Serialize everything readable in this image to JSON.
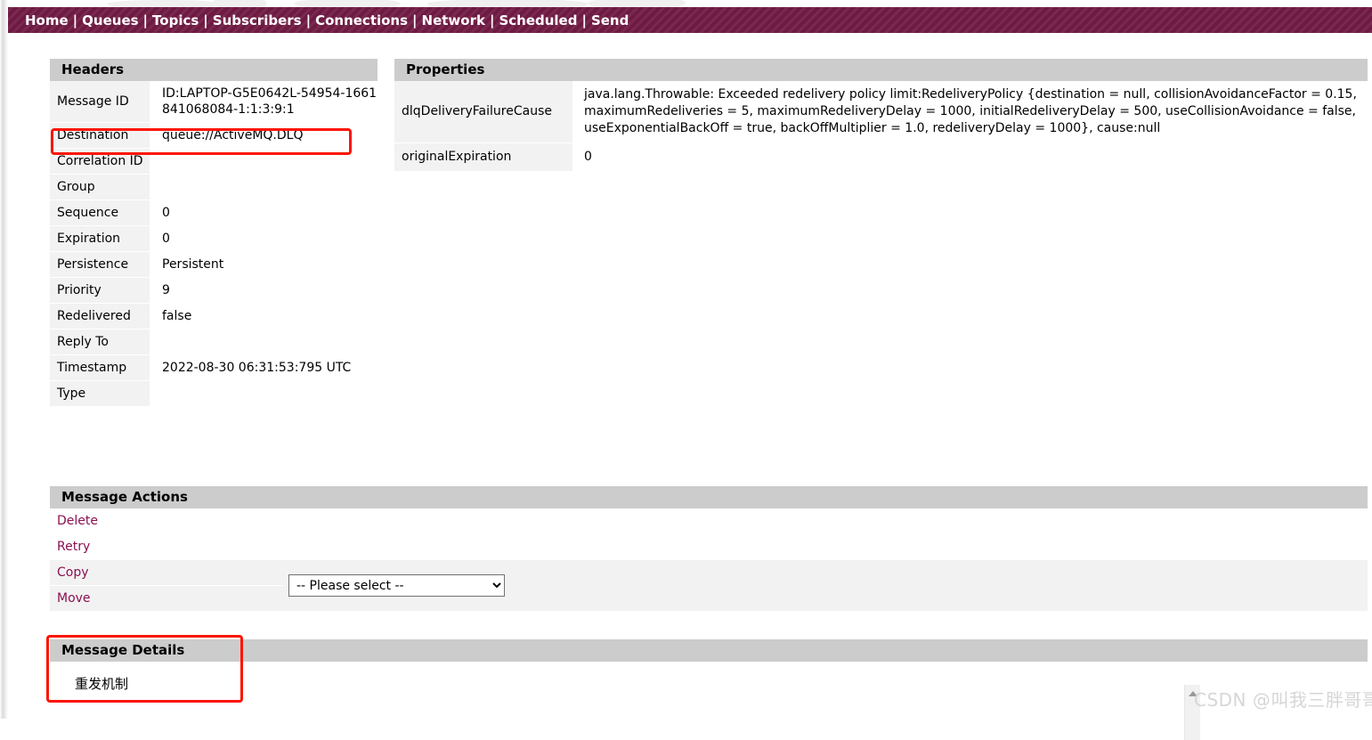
{
  "nav": {
    "items": [
      {
        "label": "Home"
      },
      {
        "label": "Queues"
      },
      {
        "label": "Topics"
      },
      {
        "label": "Subscribers"
      },
      {
        "label": "Connections"
      },
      {
        "label": "Network"
      },
      {
        "label": "Scheduled"
      },
      {
        "label": "Send"
      }
    ],
    "separator": "|",
    "background_color": "#6e1a42",
    "text_color": "#ffffff"
  },
  "headers_panel": {
    "title": "Headers",
    "rows": [
      {
        "key": "Message ID",
        "value": "ID:LAPTOP-G5E0642L-54954-1661841068084-1:1:3:9:1"
      },
      {
        "key": "Destination",
        "value": "queue://ActiveMQ.DLQ"
      },
      {
        "key": "Correlation ID",
        "value": ""
      },
      {
        "key": "Group",
        "value": ""
      },
      {
        "key": "Sequence",
        "value": "0"
      },
      {
        "key": "Expiration",
        "value": "0"
      },
      {
        "key": "Persistence",
        "value": "Persistent"
      },
      {
        "key": "Priority",
        "value": "9"
      },
      {
        "key": "Redelivered",
        "value": "false"
      },
      {
        "key": "Reply To",
        "value": ""
      },
      {
        "key": "Timestamp",
        "value": "2022-08-30 06:31:53:795 UTC"
      },
      {
        "key": "Type",
        "value": ""
      }
    ]
  },
  "properties_panel": {
    "title": "Properties",
    "rows": [
      {
        "key": "dlqDeliveryFailureCause",
        "value": "java.lang.Throwable: Exceeded redelivery policy limit:RedeliveryPolicy {destination = null, collisionAvoidanceFactor = 0.15, maximumRedeliveries = 5, maximumRedeliveryDelay = 1000, initialRedeliveryDelay = 500, useCollisionAvoidance = false, useExponentialBackOff = true, backOffMultiplier = 1.0, redeliveryDelay = 1000}, cause:null"
      },
      {
        "key": "originalExpiration",
        "value": "0"
      }
    ]
  },
  "message_actions": {
    "title": "Message Actions",
    "links": [
      {
        "label": "Delete"
      },
      {
        "label": "Retry"
      },
      {
        "label": "Copy"
      },
      {
        "label": "Move"
      }
    ],
    "select": {
      "selected": "-- Please select --",
      "options": [
        "-- Please select --"
      ]
    },
    "link_color": "#8a1052"
  },
  "message_details": {
    "title": "Message Details",
    "body": "重发机制"
  },
  "annotations": {
    "color": "#fc1505",
    "boxes": [
      "destination-row",
      "message-details-section"
    ]
  },
  "watermark": {
    "text": "CSDN @叫我三胖哥哥"
  }
}
